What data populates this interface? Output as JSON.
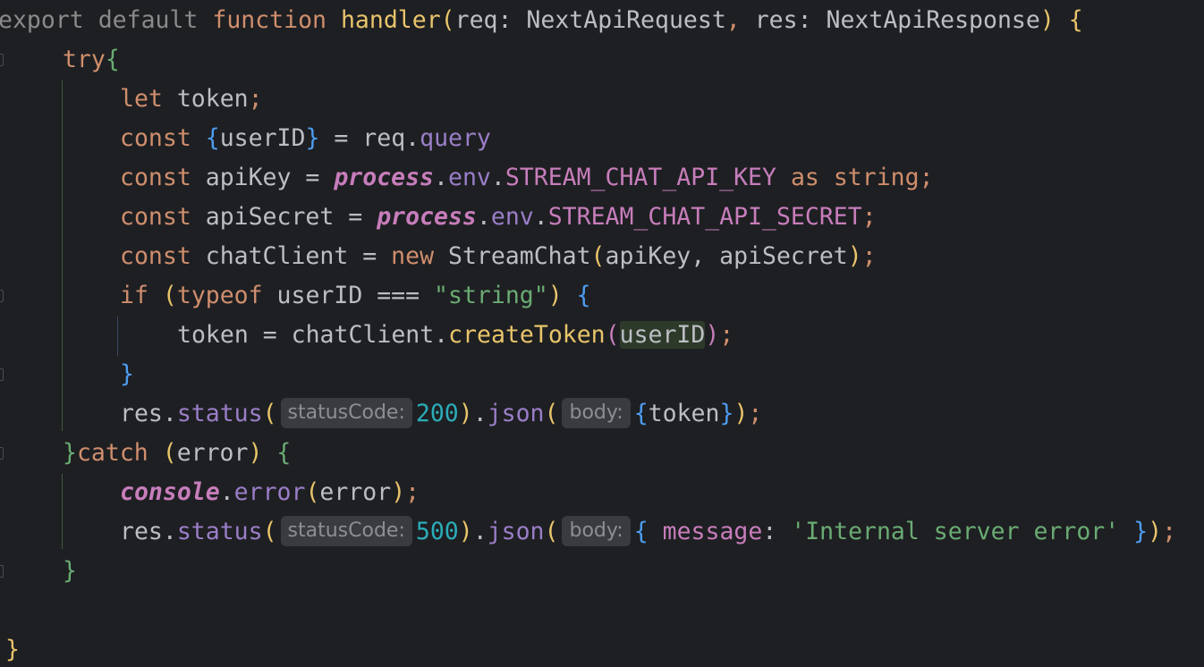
{
  "editor": {
    "line1": {
      "export": "export",
      "default": "default",
      "function": "function",
      "name": "handler",
      "open": "(",
      "p1": "req",
      "colon1": ": ",
      "t1": "NextApiRequest",
      "comma": ", ",
      "p2": "res",
      "colon2": ": ",
      "t2": "NextApiResponse",
      "close": ")",
      "brace": "{"
    },
    "line2": {
      "try": "try",
      "brace": "{"
    },
    "line3": {
      "let": "let",
      "rest": " token",
      "semi": ";"
    },
    "line4": {
      "const": "const",
      "lb": "{",
      "id": "userID",
      "rb": "}",
      "eq": " = req.",
      "query": "query"
    },
    "line5": {
      "const": "const",
      "name": " apiKey = ",
      "process": "process",
      "dot1": ".",
      "env": "env",
      "dot2": ".",
      "key": "STREAM_CHAT_API_KEY",
      "as": "as",
      "string": "string",
      "semi": ";"
    },
    "line6": {
      "const": "const",
      "name": " apiSecret = ",
      "process": "process",
      "dot1": ".",
      "env": "env",
      "dot2": ".",
      "key": "STREAM_CHAT_API_SECRET",
      "semi": ";"
    },
    "line7": {
      "const": "const",
      "name": " chatClient = ",
      "new": "new",
      "cls": " StreamChat",
      "open": "(",
      "args": "apiKey, apiSecret",
      "close": ")",
      "semi": ";"
    },
    "line8": {
      "if": "if",
      "open": "(",
      "typeof": "typeof",
      "cond": " userID === ",
      "str": "\"string\"",
      "close": ")",
      "brace": "{"
    },
    "line9": {
      "lhs": "token = chatClient.",
      "fn": "createToken",
      "open": "(",
      "arg": "userID",
      "close": ")",
      "semi": ";"
    },
    "line10": {
      "brace": "}"
    },
    "line11": {
      "res": "res.",
      "status": "status",
      "open": "(",
      "hint": "statusCode:",
      "num": "200",
      "close": ")",
      "dot": ".",
      "json": "json",
      "open2": "(",
      "hint2": "body:",
      "lb": "{",
      "id": "token",
      "rb": "}",
      "close2": ")",
      "semi": ";"
    },
    "line12": {
      "rb": "}",
      "catch": "catch",
      "open": "(",
      "err": "error",
      "close": ")",
      "brace": "{"
    },
    "line13": {
      "console": "console",
      "dot": ".",
      "error": "error",
      "open": "(",
      "arg": "error",
      "close": ")",
      "semi": ";"
    },
    "line14": {
      "res": "res.",
      "status": "status",
      "open": "(",
      "hint": "statusCode:",
      "num": "500",
      "close": ")",
      "dot": ".",
      "json": "json",
      "open2": "(",
      "hint2": "body:",
      "lb": "{",
      "key": " message",
      "colon": ": ",
      "str": "'Internal server error'",
      "rb": "}",
      "close2": ")",
      "semi": ";"
    },
    "line15": {
      "brace": "}"
    },
    "line16": {
      "brace": "}"
    }
  },
  "colors": {
    "background": "#1e1f22",
    "keyword": "#cf8e6d",
    "function": "#e8c46b",
    "string": "#6aab73",
    "number": "#2aacb8",
    "member": "#c77dbb"
  }
}
